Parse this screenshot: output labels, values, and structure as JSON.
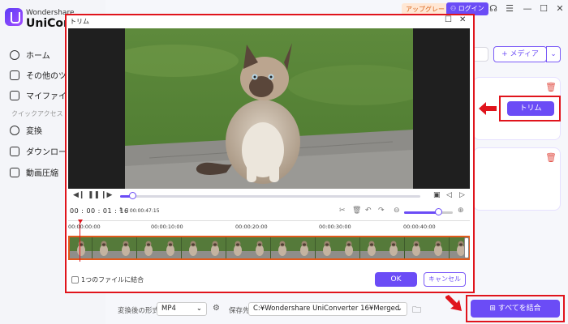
{
  "app": {
    "brand_small": "Wondershare",
    "brand_big": "UniConv",
    "accent": "#6b4cf6"
  },
  "topbar": {
    "upgrade_label": "アップグレード",
    "login_label": "ログイン",
    "icons": [
      "headset-icon",
      "menu-icon",
      "minimize-icon",
      "maximize-icon",
      "close-icon"
    ]
  },
  "sidebar": {
    "items": [
      {
        "label": "ホーム",
        "icon": "home-icon"
      },
      {
        "label": "その他のツール",
        "icon": "toolbox-icon"
      },
      {
        "label": "マイファイル",
        "icon": "file-icon"
      },
      {
        "label": "変換",
        "icon": "convert-icon"
      },
      {
        "label": "ダウンロード",
        "icon": "download-icon"
      },
      {
        "label": "動画圧縮",
        "icon": "compress-icon"
      }
    ],
    "section_label": "クイックアクセス"
  },
  "main": {
    "media_button": "+ メディア",
    "trim_button": "トリム"
  },
  "dialog": {
    "title": "トリム",
    "current_time": "00 : 00 : 01 : 16",
    "total_time": "/ 00:00:47:15",
    "progress": 0.04,
    "zoom_level": 0.7,
    "ruler_labels": [
      "00:00:00:00",
      "00:00:10:00",
      "00:00:20:00",
      "00:00:30:00",
      "00:00:40:00"
    ],
    "thumb_count": 18,
    "combine_label": "1つのファイルに結合",
    "ok_label": "OK",
    "cancel_label": "キャンセル",
    "highlight_color": "#e0141c"
  },
  "bottombar": {
    "format_label": "変換後の形式",
    "format_value": "MP4",
    "dest_label": "保存先",
    "dest_value": "C:¥Wondershare UniConverter 16¥Merged",
    "merge_all_label": "すべてを結合"
  }
}
